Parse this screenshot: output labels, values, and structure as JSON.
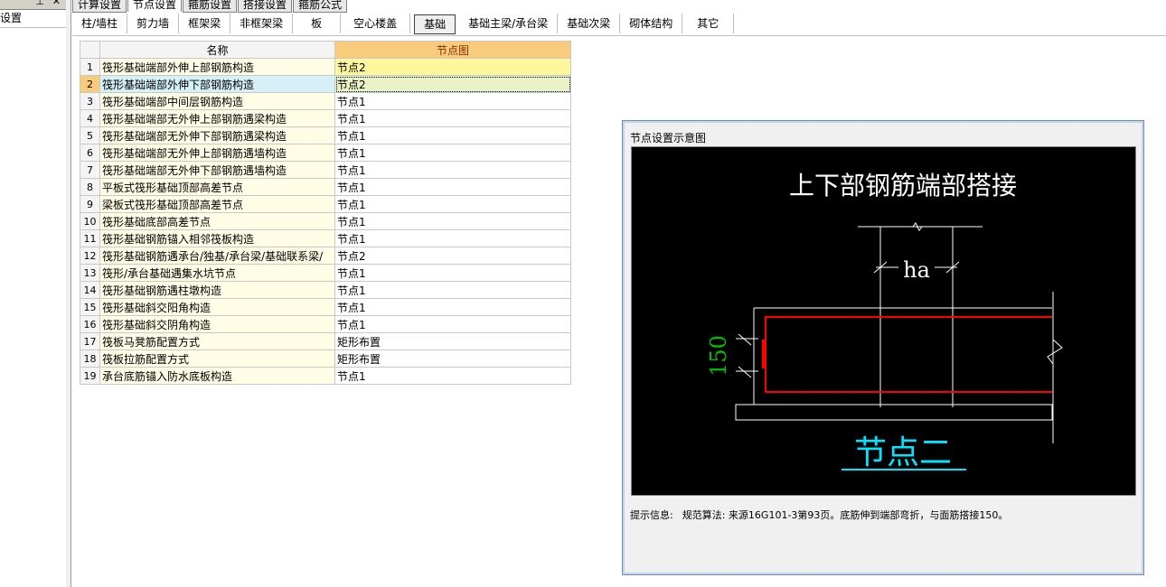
{
  "left_panel": {
    "item": "设置"
  },
  "top_tabs": [
    {
      "label": "计算设置",
      "active": false
    },
    {
      "label": "节点设置",
      "active": true
    },
    {
      "label": "箍筋设置",
      "active": false
    },
    {
      "label": "搭接设置",
      "active": false
    },
    {
      "label": "箍筋公式",
      "active": false
    }
  ],
  "sub_tabs": [
    {
      "label": "柱/墙柱",
      "active": false
    },
    {
      "label": "剪力墙",
      "active": false
    },
    {
      "label": "框架梁",
      "active": false
    },
    {
      "label": "非框架梁",
      "active": false
    },
    {
      "label": "板",
      "active": false
    },
    {
      "label": "空心楼盖",
      "active": false
    },
    {
      "label": "基础",
      "active": true
    },
    {
      "label": "基础主梁/承台梁",
      "active": false
    },
    {
      "label": "基础次梁",
      "active": false
    },
    {
      "label": "砌体结构",
      "active": false
    },
    {
      "label": "其它",
      "active": false
    }
  ],
  "grid": {
    "headers": {
      "name": "名称",
      "node": "节点图"
    },
    "rows": [
      {
        "num": "1",
        "name": "筏形基础端部外伸上部钢筋构造",
        "node": "节点2"
      },
      {
        "num": "2",
        "name": "筏形基础端部外伸下部钢筋构造",
        "node": "节点2"
      },
      {
        "num": "3",
        "name": "筏形基础端部中间层钢筋构造",
        "node": "节点1"
      },
      {
        "num": "4",
        "name": "筏形基础端部无外伸上部钢筋遇梁构造",
        "node": "节点1"
      },
      {
        "num": "5",
        "name": "筏形基础端部无外伸下部钢筋遇梁构造",
        "node": "节点1"
      },
      {
        "num": "6",
        "name": "筏形基础端部无外伸上部钢筋遇墙构造",
        "node": "节点1"
      },
      {
        "num": "7",
        "name": "筏形基础端部无外伸下部钢筋遇墙构造",
        "node": "节点1"
      },
      {
        "num": "8",
        "name": "平板式筏形基础顶部高差节点",
        "node": "节点1"
      },
      {
        "num": "9",
        "name": "梁板式筏形基础顶部高差节点",
        "node": "节点1"
      },
      {
        "num": "10",
        "name": "筏形基础底部高差节点",
        "node": "节点1"
      },
      {
        "num": "11",
        "name": "筏形基础钢筋锚入相邻筏板构造",
        "node": "节点1"
      },
      {
        "num": "12",
        "name": "筏形基础钢筋遇承台/独基/承台梁/基础联系梁/",
        "node": "节点2"
      },
      {
        "num": "13",
        "name": "筏形/承台基础遇集水坑节点",
        "node": "节点1"
      },
      {
        "num": "14",
        "name": "筏形基础钢筋遇柱墩构造",
        "node": "节点1"
      },
      {
        "num": "15",
        "name": "筏形基础斜交阳角构造",
        "node": "节点1"
      },
      {
        "num": "16",
        "name": "筏形基础斜交阴角构造",
        "node": "节点1"
      },
      {
        "num": "17",
        "name": "筏板马凳筋配置方式",
        "node": "矩形布置"
      },
      {
        "num": "18",
        "name": "筏板拉筋配置方式",
        "node": "矩形布置"
      },
      {
        "num": "19",
        "name": "承台底筋锚入防水底板构造",
        "node": "节点1"
      }
    ],
    "selected_row": 1,
    "focused_row": 2
  },
  "dialog": {
    "title": "节点设置示意图",
    "diagram": {
      "heading": "上下部钢筋端部搭接",
      "dim_ha": "ha",
      "dim_150": "150",
      "caption": "节点二",
      "colors": {
        "background": "#000000",
        "lines": "#ffffff",
        "rebar": "#ff0000",
        "dimension": "#00c000",
        "caption": "#00e5ff"
      }
    },
    "hint_label": "提示信息:",
    "hint_text": "规范算法: 来源16G101-3第93页。底筋伸到端部弯折，与面筋搭接150。"
  }
}
